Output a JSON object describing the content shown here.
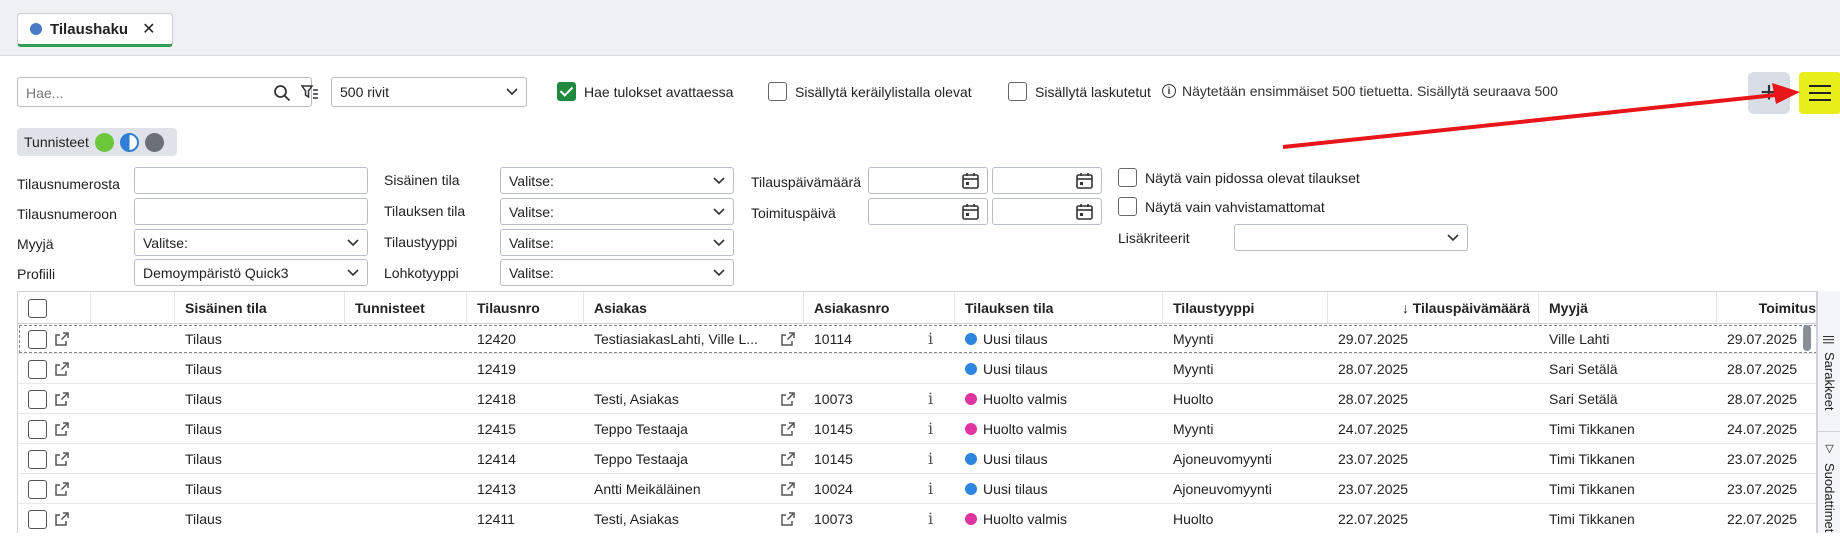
{
  "tab": {
    "label": "Tilaushaku",
    "close": "✕"
  },
  "toolbar": {
    "search_placeholder": "Hae...",
    "rows_select": "500 rivit",
    "opt_fetch_on_open": "Hae tulokset avattaessa",
    "opt_include_picklist": "Sisällytä keräilylistalla olevat",
    "opt_include_invoiced": "Sisällytä laskutetut",
    "info": "Näytetään ensimmäiset 500 tietuetta. Sisällytä seuraava 500",
    "add": "+"
  },
  "tags": {
    "label": "Tunnisteet"
  },
  "filters": {
    "order_from": "Tilausnumerosta",
    "order_to": "Tilausnumeroon",
    "seller": "Myyjä",
    "seller_value": "Valitse:",
    "profile": "Profiili",
    "profile_value": "Demoympäristö Quick3",
    "internal_state": "Sisäinen tila",
    "order_state": "Tilauksen tila",
    "order_type": "Tilaustyyppi",
    "block_type": "Lohkotyyppi",
    "select_placeholder": "Valitse:",
    "order_date": "Tilauspäivämäärä",
    "delivery_date": "Toimituspäivä",
    "show_on_hold": "Näytä vain pidossa olevat tilaukset",
    "show_unconfirmed": "Näytä vain vahvistamattomat",
    "extra": "Lisäkriteerit"
  },
  "grid": {
    "headers": [
      "Sisäinen tila",
      "Tunnisteet",
      "Tilausnro",
      "Asiakas",
      "Asiakasnro",
      "Tilauksen tila",
      "Tilaustyyppi",
      "↓ Tilauspäivämäärä",
      "Myyjä",
      "Toimitus"
    ],
    "rows": [
      {
        "internal": "Tilaus",
        "nro": "12420",
        "customer": "TestiasiakasLahti, Ville L...",
        "custno": "10114",
        "state": "Uusi tilaus",
        "state_color": "#2f86e0",
        "type": "Myynti",
        "date": "29.07.2025",
        "seller": "Ville Lahti",
        "delivery": "29.07.2025"
      },
      {
        "internal": "Tilaus",
        "nro": "12419",
        "customer": "",
        "custno": "",
        "state": "Uusi tilaus",
        "state_color": "#2f86e0",
        "type": "Myynti",
        "date": "28.07.2025",
        "seller": "Sari Setälä",
        "delivery": "28.07.2025"
      },
      {
        "internal": "Tilaus",
        "nro": "12418",
        "customer": "Testi, Asiakas",
        "custno": "10073",
        "state": "Huolto valmis",
        "state_color": "#e0359f",
        "type": "Huolto",
        "date": "28.07.2025",
        "seller": "Sari Setälä",
        "delivery": "28.07.2025"
      },
      {
        "internal": "Tilaus",
        "nro": "12415",
        "customer": "Teppo Testaaja",
        "custno": "10145",
        "state": "Huolto valmis",
        "state_color": "#e0359f",
        "type": "Myynti",
        "date": "24.07.2025",
        "seller": "Timi Tikkanen",
        "delivery": "24.07.2025"
      },
      {
        "internal": "Tilaus",
        "nro": "12414",
        "customer": "Teppo Testaaja",
        "custno": "10145",
        "state": "Uusi tilaus",
        "state_color": "#2f86e0",
        "type": "Ajoneuvomyynti",
        "date": "23.07.2025",
        "seller": "Timi Tikkanen",
        "delivery": "23.07.2025"
      },
      {
        "internal": "Tilaus",
        "nro": "12413",
        "customer": "Antti Meikäläinen",
        "custno": "10024",
        "state": "Uusi tilaus",
        "state_color": "#2f86e0",
        "type": "Ajoneuvomyynti",
        "date": "23.07.2025",
        "seller": "Timi Tikkanen",
        "delivery": "23.07.2025"
      },
      {
        "internal": "Tilaus",
        "nro": "12411",
        "customer": "Testi, Asiakas",
        "custno": "10073",
        "state": "Huolto valmis",
        "state_color": "#e0359f",
        "type": "Huolto",
        "date": "22.07.2025",
        "seller": "Timi Tikkanen",
        "delivery": "22.07.2025"
      }
    ]
  },
  "side": {
    "columns": "Sarakkeet",
    "filters": "Suodattimet"
  },
  "colors": {
    "accent_green": "#1f8a3d",
    "highlight": "#e8ee1a",
    "annotation_red": "#e8161b"
  }
}
